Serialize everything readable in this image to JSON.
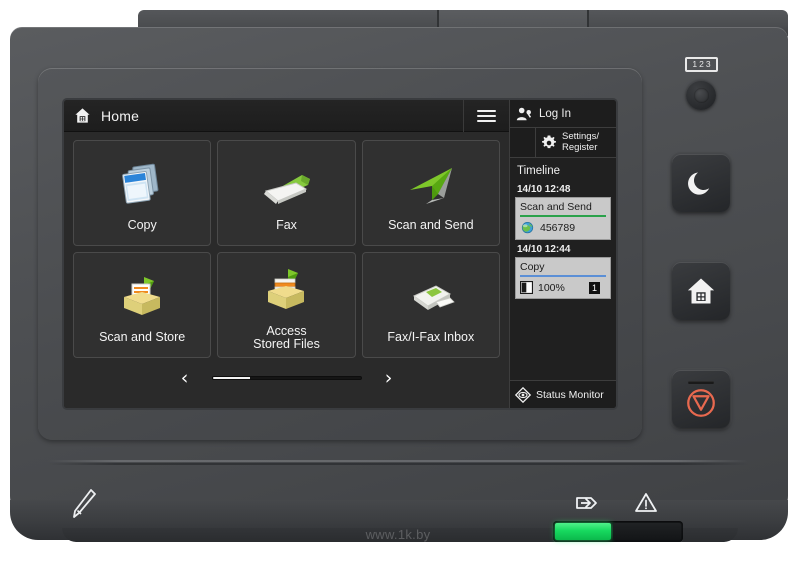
{
  "screen": {
    "topbar": {
      "home_icon": "home-icon",
      "title": "Home",
      "menu_icon": "hamburger-menu-icon"
    },
    "tiles": [
      {
        "label": "Copy",
        "icon": "copy-icon"
      },
      {
        "label": "Fax",
        "icon": "fax-icon"
      },
      {
        "label": "Scan and Send",
        "icon": "scan-and-send-icon"
      },
      {
        "label": "Scan and Store",
        "icon": "scan-and-store-icon"
      },
      {
        "label": "Access\nStored Files",
        "icon": "access-stored-files-icon"
      },
      {
        "label": "Fax/I-Fax Inbox",
        "icon": "fax-inbox-icon"
      }
    ],
    "pager": {
      "prev_label": "‹",
      "next_label": "›",
      "total_pages": 4,
      "current_page": 1
    },
    "sidebar": {
      "login_label": "Log In",
      "login_icon": "user-login-icon",
      "settings_label": "Settings/\nRegister",
      "settings_icon": "gear-icon",
      "timeline_label": "Timeline",
      "timeline_items": [
        {
          "time": "14/10 12:48",
          "job": "Scan and Send",
          "accent": "#2aa14a",
          "meta_icon": "globe-icon",
          "meta_value": "456789",
          "badge": ""
        },
        {
          "time": "14/10 12:44",
          "job": "Copy",
          "accent": "#5b8fd6",
          "meta_icon": "density-icon",
          "meta_value": "100%",
          "badge": "1"
        }
      ],
      "status_label": "Status Monitor",
      "status_icon": "status-monitor-icon"
    }
  },
  "hardware": {
    "numeric_keys_label": [
      "1",
      "2",
      "3"
    ],
    "numeric_keys_button": "numeric-keys-button",
    "energy_saver_button": "energy-saver-moon-icon",
    "home_button": "home-key-icon",
    "stop_button": "stop-key-icon",
    "pen_icon": "stylus-pen-icon",
    "data_indicator_icon": "data-processing-indicator-icon",
    "error_indicator_icon": "error-warning-indicator-icon",
    "main_power_led": "main-power-led"
  },
  "watermark": "www.1k.by"
}
